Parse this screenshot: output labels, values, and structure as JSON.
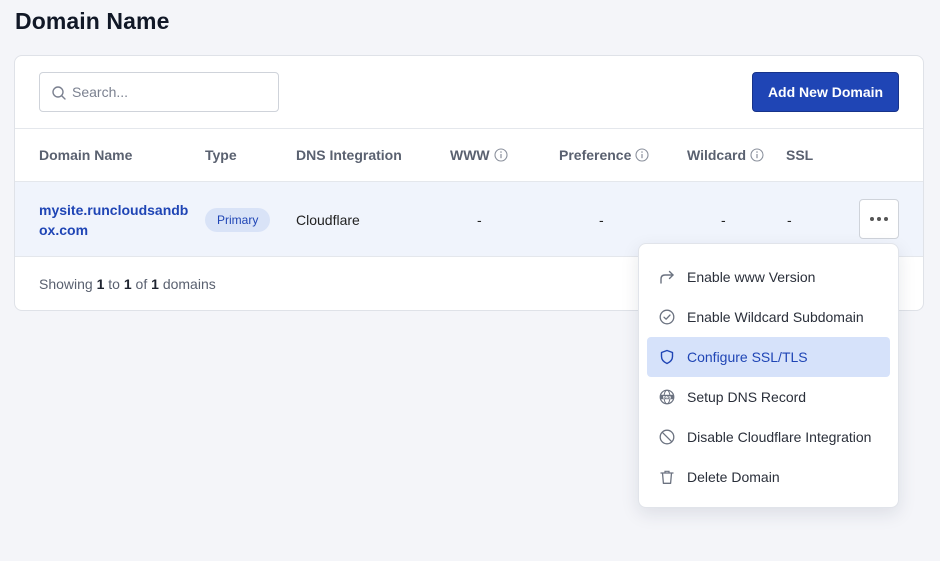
{
  "page": {
    "title": "Domain Name"
  },
  "search": {
    "placeholder": "Search..."
  },
  "actions": {
    "add_label": "Add New Domain"
  },
  "table": {
    "columns": {
      "domain": "Domain Name",
      "type": "Type",
      "dns": "DNS Integration",
      "www": "WWW",
      "preference": "Preference",
      "wildcard": "Wildcard",
      "ssl": "SSL"
    },
    "rows": [
      {
        "domain": "mysite.runcloudsandbox.com",
        "type": "Primary",
        "dns": "Cloudflare",
        "www": "-",
        "preference": "-",
        "wildcard": "-",
        "ssl": "-"
      }
    ],
    "footer": {
      "prefix": "Showing",
      "from": "1",
      "to_word": "to",
      "to": "1",
      "of_word": "of",
      "total": "1",
      "suffix": "domains"
    }
  },
  "menu": {
    "items": [
      {
        "label": "Enable www Version",
        "icon": "share-arrow-icon"
      },
      {
        "label": "Enable Wildcard Subdomain",
        "icon": "check-circle-icon"
      },
      {
        "label": "Configure SSL/TLS",
        "icon": "shield-icon",
        "active": true
      },
      {
        "label": "Setup DNS Record",
        "icon": "dns-globe-icon"
      },
      {
        "label": "Disable Cloudflare Integration",
        "icon": "ban-icon"
      },
      {
        "label": "Delete Domain",
        "icon": "trash-icon"
      }
    ]
  },
  "colors": {
    "accent": "#1f45b5",
    "active_bg": "#d6e2fa",
    "row_bg": "#f0f4fc"
  }
}
